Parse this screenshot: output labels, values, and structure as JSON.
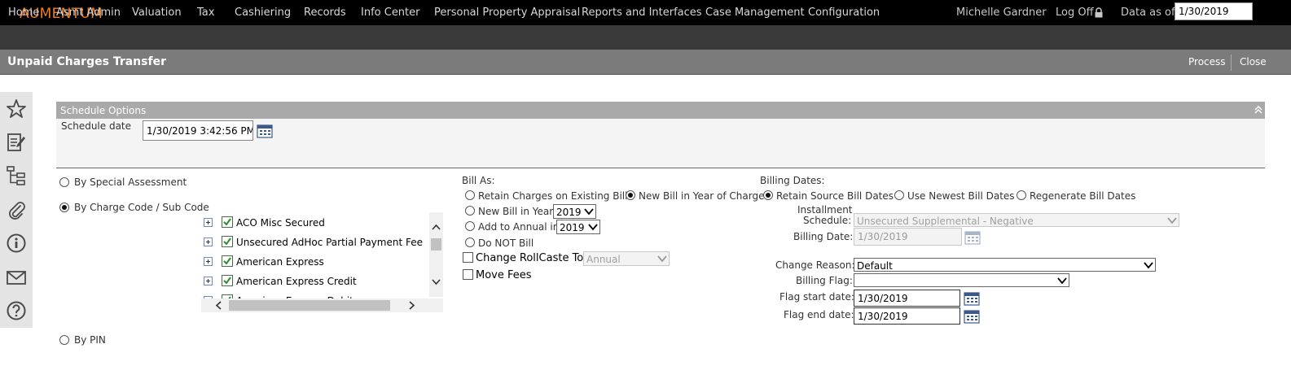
{
  "app": {
    "logo": "AUMENTUM"
  },
  "header": {
    "user": "Michelle Gardner",
    "logoff": "Log Off",
    "data_as_of_label": "Data as of:",
    "data_as_of_value": "1/30/2019"
  },
  "nav": {
    "items": [
      "Home",
      "Asmt Admin",
      "Valuation",
      "Tax",
      "Cashiering",
      "Records",
      "Info Center",
      "Personal Property Appraisal",
      "Reports and Interfaces",
      "Case Management",
      "Configuration"
    ]
  },
  "page": {
    "title": "Unpaid Charges Transfer",
    "process": "Process",
    "close": "Close"
  },
  "left_toolbar": {
    "icons": [
      "star-icon",
      "edit-document-icon",
      "hierarchy-icon",
      "attachment-icon",
      "info-icon",
      "mail-icon",
      "help-icon"
    ]
  },
  "schedule": {
    "header": "Schedule Options",
    "date_label": "Schedule date",
    "date_value": "1/30/2019 3:42:56 PM"
  },
  "modes": {
    "special_assessment": "By Special Assessment",
    "charge_code": "By Charge Code / Sub Code",
    "pin": "By PIN",
    "selected": "charge_code"
  },
  "tree": {
    "items": [
      "ACO Misc Secured",
      "Unsecured AdHoc Partial Payment Fee",
      "American Express",
      "American Express Credit",
      "American Express Debit"
    ]
  },
  "bill_as": {
    "label": "Bill As:",
    "retain": "Retain Charges on Existing Bill",
    "new_year_of_charge": "New Bill in Year of Charge",
    "new_bill_in_year": "New Bill in Year",
    "new_bill_year": "2019",
    "add_to_annual": "Add to Annual in",
    "add_year": "2019",
    "do_not_bill": "Do NOT Bill",
    "change_rollcaste": "Change RollCaste To:",
    "rollcaste_value": "Annual",
    "move_fees": "Move Fees"
  },
  "billing_dates": {
    "label": "Billing Dates:",
    "retain_source": "Retain Source Bill Dates",
    "use_newest": "Use Newest Bill Dates",
    "regenerate": "Regenerate Bill Dates",
    "installment_label_1": "Installment",
    "installment_label_2": "Schedule:",
    "installment_value": "Unsecured Supplemental - Negative",
    "billing_date_label": "Billing Date:",
    "billing_date_value": "1/30/2019"
  },
  "flags": {
    "change_reason_label": "Change Reason:",
    "change_reason_value": "Default",
    "billing_flag_label": "Billing Flag:",
    "billing_flag_value": "",
    "flag_start_label": "Flag start date:",
    "flag_start_value": "1/30/2019",
    "flag_end_label": "Flag end date:",
    "flag_end_value": "1/30/2019"
  },
  "colors": {
    "logo": "#f07d1e",
    "topbar": "#000000",
    "navbar": "#3a3a3a",
    "titlebar": "#7b7b7b",
    "section_header": "#a9a9a9"
  }
}
